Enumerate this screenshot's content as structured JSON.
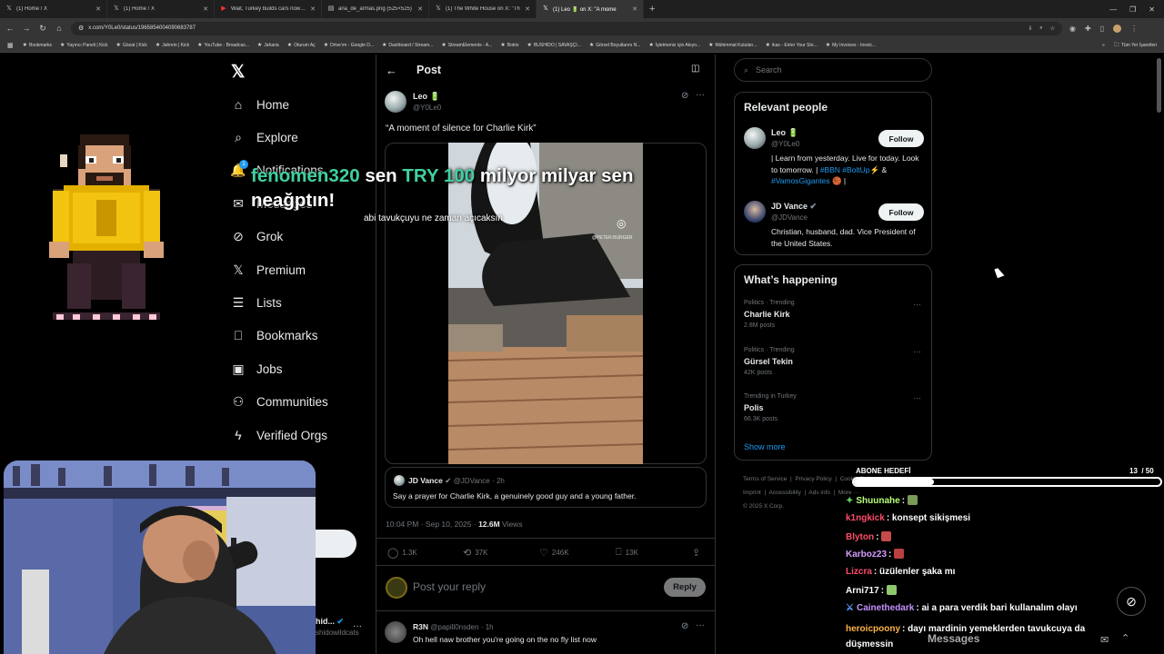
{
  "browser": {
    "tabs": [
      {
        "icon": "x-logo-icon",
        "title": "(1) Home / X"
      },
      {
        "icon": "x-logo-icon",
        "title": "(1) Home / X"
      },
      {
        "icon": "youtube-icon",
        "title": "Wait, Turkey builds cars now? T"
      },
      {
        "icon": "file-icon",
        "title": "ana_de_armas.png (525×525)"
      },
      {
        "icon": "x-logo-icon",
        "title": "(1) The White House on X: \"Th"
      },
      {
        "icon": "x-logo-icon",
        "title": "(1) Leo 🔋 on X: \"A mome"
      }
    ],
    "url": "x.com/Y0Le0/status/1965854004090683787",
    "bookmarks": [
      "Bookmarks",
      "Yayıncı Paneli | Kick",
      "Gözat | Kick",
      "Jahrein | Kick",
      "YouTube - Broadcas...",
      "Jaharia",
      "Oturum Aç",
      "Drive'ım - Google D...",
      "Dashboard / Stream...",
      "StreamElements - A...",
      "Botrix",
      "BUSHIDO | SAVAŞÇI...",
      "Görsel Boyutlarını N...",
      "İşletmeniz için Akıyo...",
      "Mühimmat Kutuları...",
      "ikas - Enter Your Sto...",
      "My Invoices - Invoic..."
    ],
    "all_bookmarks": "Tüm Yer İşaretleri"
  },
  "nav": {
    "items": [
      "Home",
      "Explore",
      "Notifications",
      "Messages",
      "Grok",
      "Premium",
      "Lists",
      "Bookmarks",
      "Jobs",
      "Communities",
      "Verified Orgs"
    ],
    "notif_badge": "1"
  },
  "post": {
    "header": "Post",
    "author_name": "Leo 🔋",
    "author_handle": "@Y0Le0",
    "text": "“A moment of silence for Charlie Kirk”",
    "video_watermark": "@PETER.BURGER",
    "quote": {
      "name": "JD Vance",
      "handle": "@JDVance",
      "time": "· 2h",
      "text": "Say a prayer for Charlie Kirk, a genuinely good guy and a young father."
    },
    "timestamp": "10:04 PM · Sep 10, 2025 · ",
    "views_count": "12.6M",
    "views_label": " Views",
    "stats": {
      "replies": "1.3K",
      "reposts": "37K",
      "likes": "246K",
      "bookmarks": "13K"
    },
    "reply_placeholder": "Post your reply",
    "reply_button": "Reply"
  },
  "reply": {
    "name": "R3N",
    "handle": "@papill0nsden",
    "time": "· 1h",
    "text": "Oh hell naw brother you're going on the no fly list now"
  },
  "sidebar": {
    "search_placeholder": "Search",
    "relevant_title": "Relevant people",
    "people": [
      {
        "name": "Leo 🔋",
        "handle": "@Y0Le0",
        "bio_a": "| Learn from yesterday. Live for today. Look to tomorrow. | ",
        "bio_tags": "#BBN #BoltUp⚡",
        "bio_b": "& ",
        "bio_tag2": "#VamosGigantes",
        "bio_c": " 🏀 |",
        "follow": "Follow"
      },
      {
        "name": "JD Vance",
        "handle": "@JDVance",
        "bio": "Christian, husband, dad. Vice President of the United States.",
        "follow": "Follow"
      }
    ],
    "happening_title": "What’s happening",
    "trends": [
      {
        "meta": "Politics · Trending",
        "name": "Charlie Kirk",
        "posts": "2.8M posts"
      },
      {
        "meta": "Politics · Trending",
        "name": "Gürsel Tekin",
        "posts": "42K posts"
      },
      {
        "meta": "Trending in Turkey",
        "name": "Polis",
        "posts": "66.3K posts"
      }
    ],
    "show_more": "Show more",
    "footer": [
      "Terms of Service",
      "Privacy Policy",
      "Cookie Policy",
      "Accessibility",
      "Ads info",
      "More ···",
      "Imprint"
    ],
    "copyright": "© 2025 X Corp."
  },
  "overlay": {
    "donation_user": "fenomen320",
    "donation_mid": " sen ",
    "donation_amount": "TRY 100",
    "donation_rest": " milyor milyar sen neağptın!",
    "donation_sub": "abi tavukçuyu ne zaman açıcaksın",
    "goal_label": "ABONE HEDEFİ",
    "goal_current": "13",
    "goal_total": "/ 50",
    "goal_fraction": 0.26,
    "profile_name": "Bushid...",
    "profile_handle": "@bushidowildcats",
    "messages_label": "Messages"
  },
  "chat": [
    {
      "name": "Shuunahe",
      "color": "#b9ff7a",
      "msg": ""
    },
    {
      "name": "k1ngkick",
      "color": "#ff4d6a",
      "msg": "konsept sikişmesi"
    },
    {
      "name": "Blyton",
      "color": "#ff4d6a",
      "msg": ""
    },
    {
      "name": "Karboz23",
      "color": "#d59cff",
      "msg": ""
    },
    {
      "name": "Lizcra",
      "color": "#ff4d6a",
      "msg": "üzülenler şaka mı"
    },
    {
      "name": "Arni717",
      "color": "#ffffff",
      "msg": ""
    },
    {
      "name": "Cainethedark",
      "color": "#c592ff",
      "msg": "ai a para verdik bari kullanalım olayı"
    },
    {
      "name": "heroicpoony",
      "color": "#ffb347",
      "msg": "dayı mardinin yemeklerden tavukcuya da düşmessin"
    }
  ]
}
